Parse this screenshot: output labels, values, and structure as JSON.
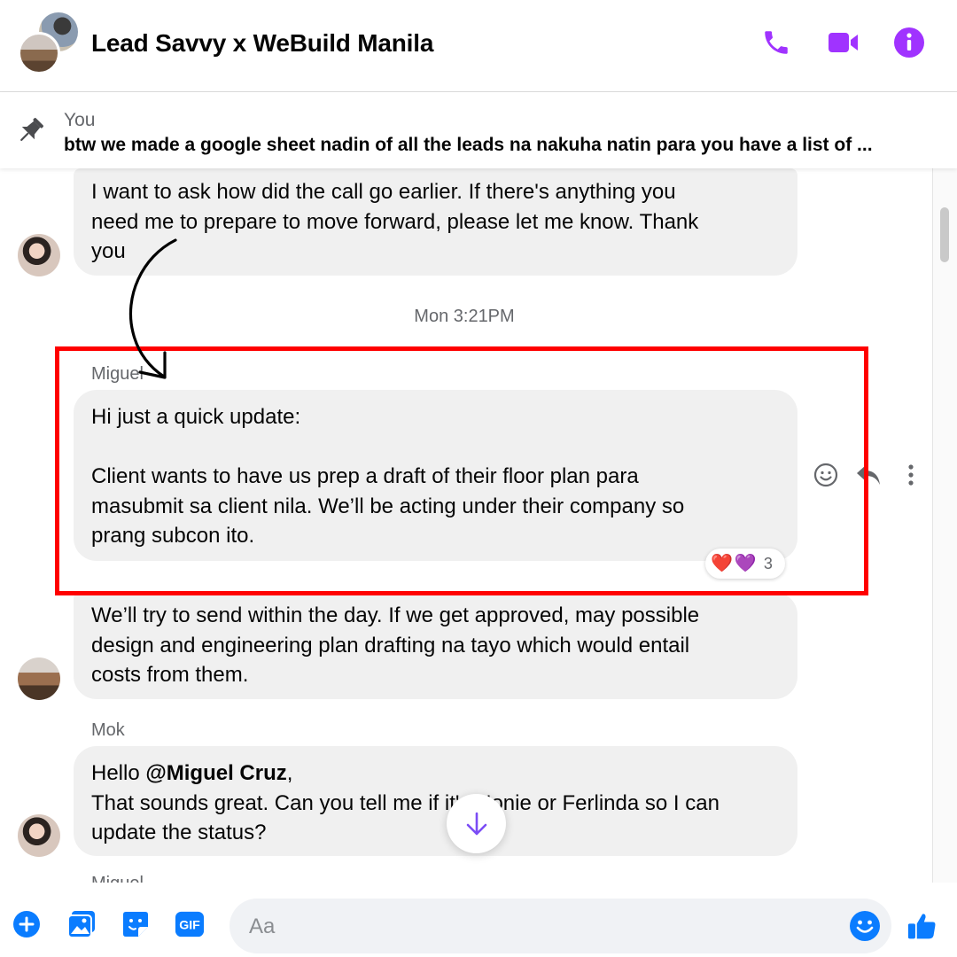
{
  "header": {
    "title": "Lead Savvy x WeBuild Manila",
    "icons": [
      "phone-icon",
      "video-camera-icon",
      "info-icon"
    ],
    "accent_color": "#a033ff"
  },
  "pinned": {
    "sender": "You",
    "text": "btw we made a google sheet nadin of all the leads na nakuha natin para you have a list of ..."
  },
  "messages": {
    "m1": {
      "lines": [
        "I want to ask how did the call go earlier. If there's anything you",
        "need me to prepare to move forward, please let me know. Thank",
        "you"
      ]
    },
    "timestamp": "Mon 3:21PM",
    "m2": {
      "sender": "Miguel",
      "lines": [
        "Hi just a quick update:",
        "",
        "Client wants to have us prep a draft of their floor plan para",
        "masubmit sa client nila. We’ll be acting under their company so",
        "prang subcon ito."
      ],
      "reactions": [
        "❤️",
        "💜"
      ],
      "reaction_count": "3"
    },
    "m3": {
      "lines": [
        "We’ll try to send within the day. If we get approved, may possible",
        "design and engineering plan drafting na tayo which would entail",
        "costs from them."
      ]
    },
    "m4": {
      "sender": "Mok",
      "line1_prefix": "Hello ",
      "mention": "@Miguel Cruz",
      "line1_suffix": ",",
      "line2": "That sounds great. Can you tell me if it's Nonie or Ferlinda so I can",
      "line3": "update the status?"
    },
    "next_sender_partial": "Miguel"
  },
  "composer": {
    "placeholder": "Aa",
    "icons": [
      "plus-icon",
      "photo-icon",
      "sticker-icon",
      "gif-icon",
      "emoji-icon",
      "thumbs-up-icon"
    ],
    "gif_label": "GIF",
    "accent_color": "#0a7cff"
  },
  "annotation_color": "#ff0000"
}
